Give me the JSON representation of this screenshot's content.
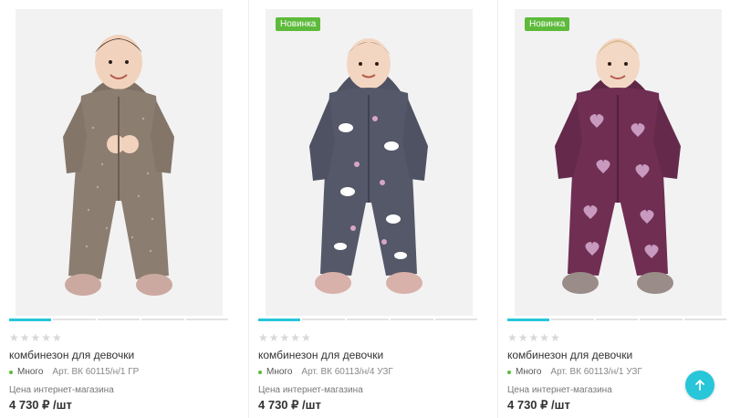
{
  "products": [
    {
      "badge": "",
      "rating_stars": "★★★★★",
      "title": "комбинезон для девочки",
      "stock": "Много",
      "article": "Арт. ВК 60115/н/1 ГР",
      "price_label": "Цена интернет-магазина",
      "price": "4 730 ₽ /шт",
      "suit_color": "#8c7d71",
      "pattern": "dots"
    },
    {
      "badge": "Новинка",
      "rating_stars": "★★★★★",
      "title": "комбинезон для девочки",
      "stock": "Много",
      "article": "Арт. ВК 60113/н/4 УЗГ",
      "price_label": "Цена интернет-магазина",
      "price": "4 730 ₽ /шт",
      "suit_color": "#545868",
      "pattern": "unicorns"
    },
    {
      "badge": "Новинка",
      "rating_stars": "★★★★★",
      "title": "комбинезон для девочки",
      "stock": "Много",
      "article": "Арт. ВК 60113/н/1 УЗГ",
      "price_label": "Цена интернет-магазина",
      "price": "4 730 ₽ /шт",
      "suit_color": "#6f2e52",
      "pattern": "hearts"
    }
  ],
  "icons": {
    "scroll_top": "arrow-up-icon",
    "star": "star-icon",
    "stock": "stock-dot-icon"
  },
  "colors": {
    "accent": "#27c6d9",
    "badge": "#5dba3b",
    "stock_dot": "#5dba3b"
  }
}
